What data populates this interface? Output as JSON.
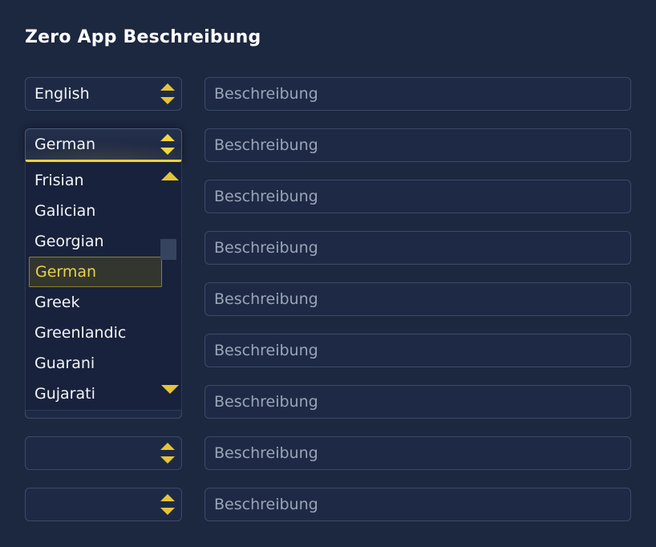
{
  "page": {
    "title": "Zero App Beschreibung",
    "background_color": "#1c2740",
    "accent_color": "#e6c437",
    "text_color": "#f2f4f8",
    "placeholder_color": "#9aa4b8"
  },
  "rows": [
    {
      "select_value": "English",
      "input_placeholder": "Beschreibung",
      "input_value": "",
      "focused": false
    },
    {
      "select_value": "German",
      "input_placeholder": "Beschreibung",
      "input_value": "",
      "focused": true
    },
    {
      "select_value": "",
      "input_placeholder": "Beschreibung",
      "input_value": "",
      "focused": false
    },
    {
      "select_value": "",
      "input_placeholder": "Beschreibung",
      "input_value": "",
      "focused": false
    },
    {
      "select_value": "",
      "input_placeholder": "Beschreibung",
      "input_value": "",
      "focused": false
    },
    {
      "select_value": "",
      "input_placeholder": "Beschreibung",
      "input_value": "",
      "focused": false
    },
    {
      "select_value": "",
      "input_placeholder": "Beschreibung",
      "input_value": "",
      "focused": false
    },
    {
      "select_value": "",
      "input_placeholder": "Beschreibung",
      "input_value": "",
      "focused": false
    },
    {
      "select_value": "",
      "input_placeholder": "Beschreibung",
      "input_value": "",
      "focused": false
    }
  ],
  "dropdown": {
    "open": true,
    "selected_value": "German",
    "options": [
      "Frisian",
      "Galician",
      "Georgian",
      "German",
      "Greek",
      "Greenlandic",
      "Guarani",
      "Gujarati"
    ],
    "scrollbar": {
      "up_arrow_icon": "triangle-up-icon",
      "down_arrow_icon": "triangle-down-icon",
      "thumb_visible": true
    },
    "highlight_text_color": "#e8d04a",
    "highlight_bg_color": "#33362e",
    "highlight_border_color": "#8a8030"
  },
  "icons": {
    "spinner_up": "triangle-up-icon",
    "spinner_down": "triangle-down-icon"
  }
}
